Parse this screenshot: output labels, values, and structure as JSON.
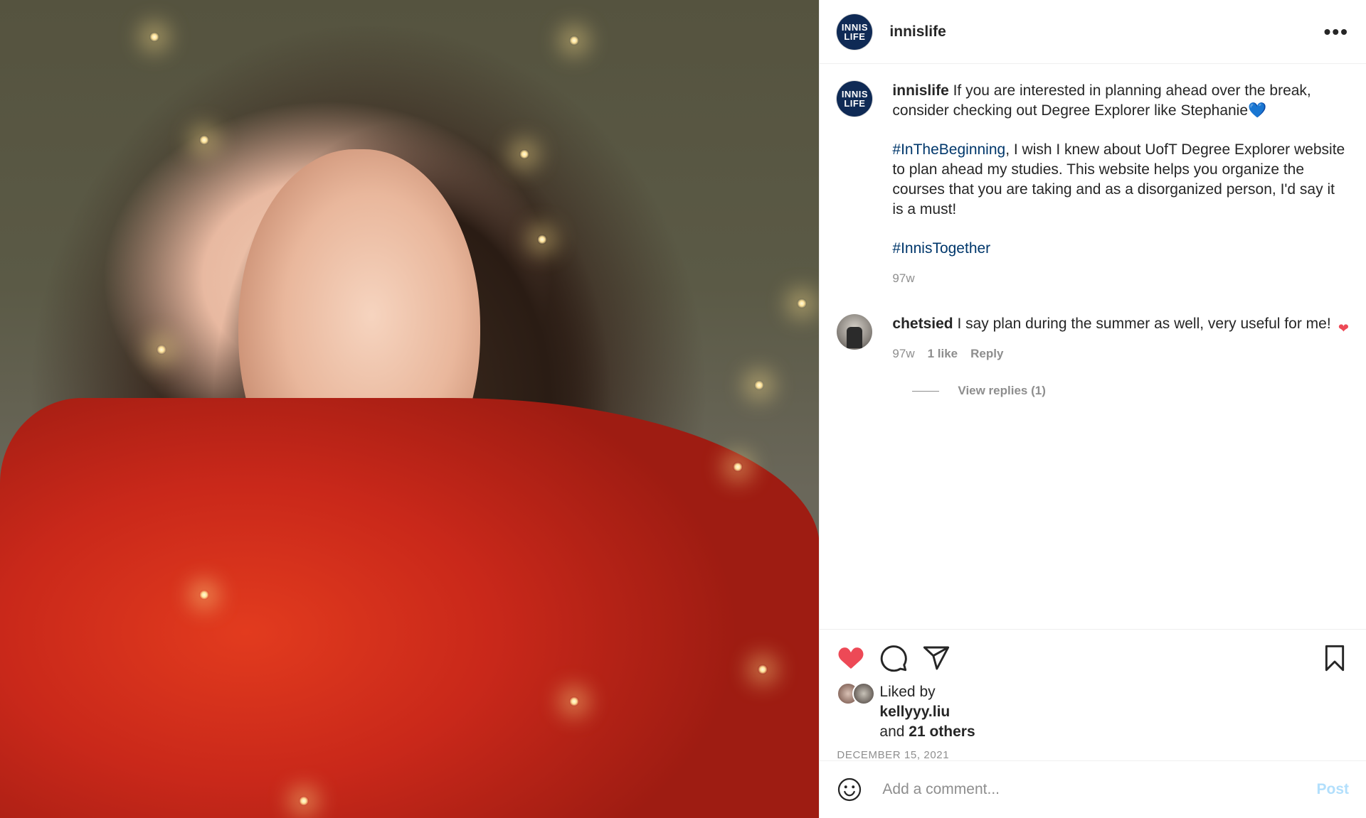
{
  "post": {
    "username": "innislife",
    "avatar_text_top": "INNIS",
    "avatar_text_bottom": "LIFE",
    "more_label": "•••"
  },
  "caption": {
    "username": "innislife",
    "line1": " If you are interested in planning ahead over the break, consider checking out Degree Explorer like Stephanie",
    "emoji": "💙",
    "hashtag1": "#InTheBeginning",
    "paragraph2": ", I wish I knew about UofT Degree Explorer website to plan ahead my studies. This website helps you organize the courses that you are taking and as a disorganized person, I'd say it is a must!",
    "hashtag2": "#InnisTogether",
    "age": "97w"
  },
  "comment": {
    "username": "chetsied",
    "text": " I say plan during the summer as well, very useful for me!",
    "age": "97w",
    "likes": "1 like",
    "reply": "Reply",
    "heart": "❤",
    "view_replies": "View replies (1)"
  },
  "likes": {
    "prefix": "Liked by",
    "user": "kellyyy.liu",
    "and": "and ",
    "others": "21 others"
  },
  "date": "DECEMBER 15, 2021",
  "add_comment": {
    "placeholder": "Add a comment...",
    "post_label": "Post"
  },
  "colors": {
    "heart_red": "#ed4956",
    "hashtag": "#00376b",
    "post_button": "#b2dffc"
  }
}
